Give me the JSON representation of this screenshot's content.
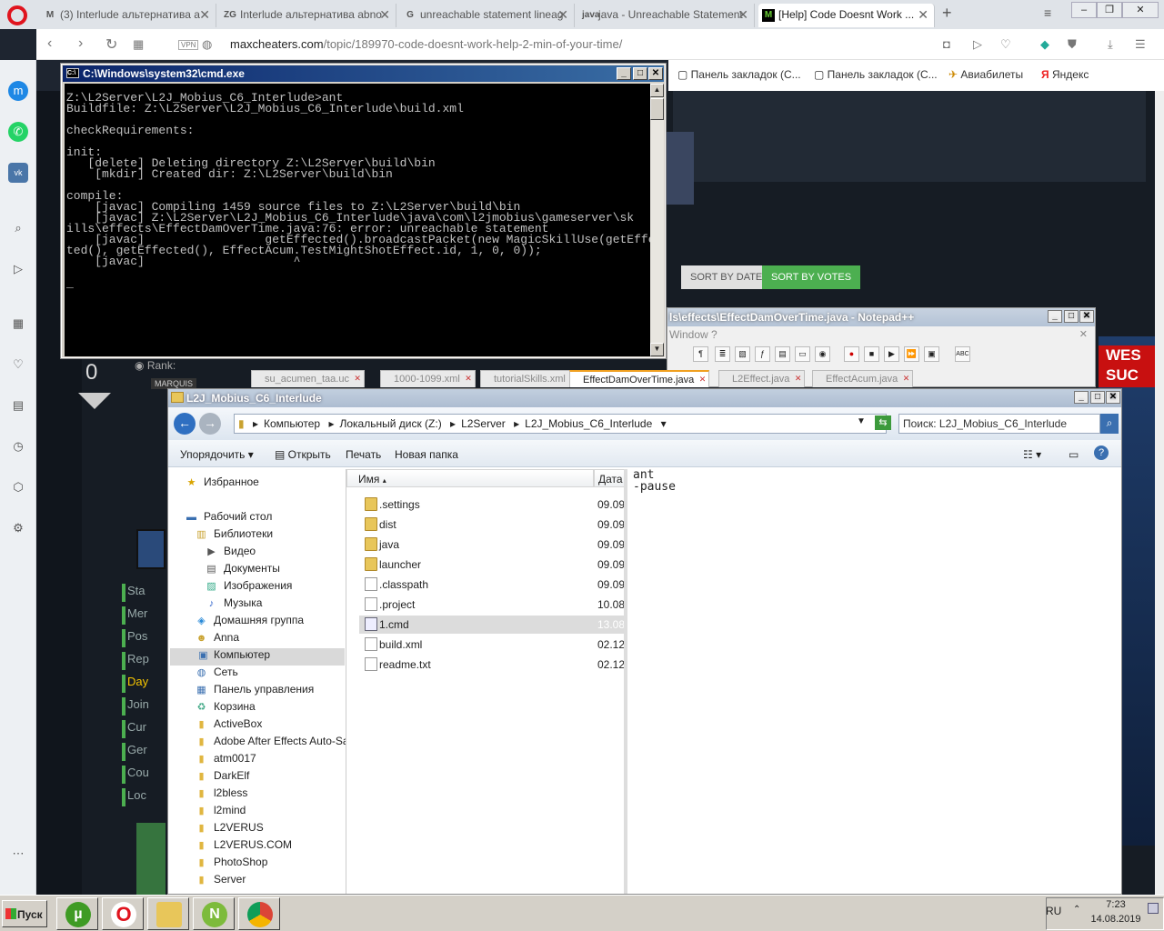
{
  "browser": {
    "tabs": [
      {
        "label": "(3) Interlude альтернатива а",
        "favicon": "M"
      },
      {
        "label": "Interlude альтернатива abno",
        "favicon": "ZG"
      },
      {
        "label": "unreachable statement lineag",
        "favicon": "G"
      },
      {
        "label": "java - Unreachable Statement",
        "favicon": "java"
      },
      {
        "label": "[Help] Code Doesnt Work ...",
        "favicon": "M"
      }
    ],
    "url_host": "maxcheaters.com",
    "url_path": "/topic/189970-code-doesnt-work-help-2-min-of-your-time/",
    "bookmarks": [
      "Панель закладок (С...",
      "Панель закладок (С...",
      "Авиабилеты",
      "Яндекс"
    ]
  },
  "webpage": {
    "sort_date": "SORT BY DATE",
    "sort_votes": "SORT BY VOTES",
    "vote_count": "0",
    "rank_label": "Rank:",
    "rank_value": "MARQUIS",
    "sidebar_links": [
      "Sta",
      "Mer",
      "Pos",
      "Rep",
      "Day",
      "Join",
      "Cur",
      "Ger",
      "Cou",
      "Loc"
    ],
    "ad_text": [
      "WES",
      "SUC"
    ]
  },
  "cmd": {
    "title": "C:\\Windows\\system32\\cmd.exe",
    "lines": [
      "Z:\\L2Server\\L2J_Mobius_C6_Interlude>ant",
      "Buildfile: Z:\\L2Server\\L2J_Mobius_C6_Interlude\\build.xml",
      "",
      "checkRequirements:",
      "",
      "init:",
      "   [delete] Deleting directory Z:\\L2Server\\build\\bin",
      "    [mkdir] Created dir: Z:\\L2Server\\build\\bin",
      "",
      "compile:",
      "    [javac] Compiling 1459 source files to Z:\\L2Server\\build\\bin",
      "    [javac] Z:\\L2Server\\L2J_Mobius_C6_Interlude\\java\\com\\l2jmobius\\gameserver\\sk",
      "ills\\effects\\EffectDamOverTime.java:76: error: unreachable statement",
      "    [javac]                 getEffected().broadcastPacket(new MagicSkillUse(getEffec",
      "ted(), getEffected(), EffectAcum.TestMightShotEffect.id, 1, 0, 0));",
      "    [javac]                     ^",
      "",
      "_"
    ]
  },
  "notepadpp": {
    "title": "ls\\effects\\EffectDamOverTime.java - Notepad++",
    "menu": "Window   ?",
    "tabs": [
      {
        "label": "su_acumen_taa.uc",
        "active": false
      },
      {
        "label": "1000-1099.xml",
        "active": false
      },
      {
        "label": "tutorialSkills.xml",
        "active": false
      },
      {
        "label": "EffectDamOverTime.java",
        "active": true
      },
      {
        "label": "L2Effect.java",
        "active": false
      },
      {
        "label": "EffectAcum.java",
        "active": false
      }
    ]
  },
  "explorer": {
    "title": "L2J_Mobius_C6_Interlude",
    "breadcrumbs": [
      "Компьютер",
      "Локальный диск (Z:)",
      "L2Server",
      "L2J_Mobius_C6_Interlude"
    ],
    "search_placeholder": "Поиск: L2J_Mobius_C6_Interlude",
    "commands": {
      "organize": "Упорядочить",
      "open": "Открыть",
      "print": "Печать",
      "new_folder": "Новая папка"
    },
    "nav": [
      {
        "label": "Избранное",
        "icon": "star-icon"
      },
      {
        "label": "Рабочий стол",
        "icon": "desktop-icon"
      },
      {
        "label": "Библиотеки",
        "icon": "library-icon"
      },
      {
        "label": "Видео",
        "icon": "video-icon"
      },
      {
        "label": "Документы",
        "icon": "document-icon"
      },
      {
        "label": "Изображения",
        "icon": "image-icon"
      },
      {
        "label": "Музыка",
        "icon": "music-icon"
      },
      {
        "label": "Домашняя группа",
        "icon": "homegroup-icon"
      },
      {
        "label": "Anna",
        "icon": "user-icon"
      },
      {
        "label": "Компьютер",
        "icon": "computer-icon"
      },
      {
        "label": "Сеть",
        "icon": "network-icon"
      },
      {
        "label": "Панель управления",
        "icon": "control-panel-icon"
      },
      {
        "label": "Корзина",
        "icon": "recycle-bin-icon"
      },
      {
        "label": "ActiveBox",
        "icon": "folder-icon"
      },
      {
        "label": "Adobe After Effects Auto-Save",
        "icon": "folder-icon"
      },
      {
        "label": "atm0017",
        "icon": "folder-icon"
      },
      {
        "label": "DarkElf",
        "icon": "folder-icon"
      },
      {
        "label": "l2bless",
        "icon": "folder-icon"
      },
      {
        "label": "l2mind",
        "icon": "folder-icon"
      },
      {
        "label": "L2VERUS",
        "icon": "folder-icon"
      },
      {
        "label": "L2VERUS.COM",
        "icon": "folder-icon"
      },
      {
        "label": "PhotoShop",
        "icon": "folder-icon"
      },
      {
        "label": "Server",
        "icon": "folder-icon"
      }
    ],
    "columns": {
      "name": "Имя",
      "date": "Дата"
    },
    "files": [
      {
        "name": ".settings",
        "date": "09.09",
        "type": "folder"
      },
      {
        "name": "dist",
        "date": "09.09",
        "type": "folder"
      },
      {
        "name": "java",
        "date": "09.09",
        "type": "folder"
      },
      {
        "name": "launcher",
        "date": "09.09",
        "type": "folder"
      },
      {
        "name": ".classpath",
        "date": "09.09",
        "type": "file"
      },
      {
        "name": ".project",
        "date": "10.08",
        "type": "file"
      },
      {
        "name": "1.cmd",
        "date": "13.08",
        "type": "cmd",
        "selected": true
      },
      {
        "name": "build.xml",
        "date": "02.12",
        "type": "file"
      },
      {
        "name": "readme.txt",
        "date": "02.12",
        "type": "file"
      }
    ],
    "preview": "ant\n-pause"
  },
  "taskbar": {
    "start": "Пуск",
    "apps": [
      {
        "name": "utorrent",
        "glyph": "µ",
        "color": "#3f9b24"
      },
      {
        "name": "opera",
        "glyph": "O",
        "color": "#e0141e"
      },
      {
        "name": "explorer",
        "glyph": "",
        "color": "#e8c65a"
      },
      {
        "name": "notepadpp",
        "glyph": "N",
        "color": "#7dbb3b"
      },
      {
        "name": "chrome",
        "glyph": "",
        "color": "#4285f4"
      }
    ],
    "lang": "RU",
    "time": "7:23",
    "date": "14.08.2019"
  }
}
